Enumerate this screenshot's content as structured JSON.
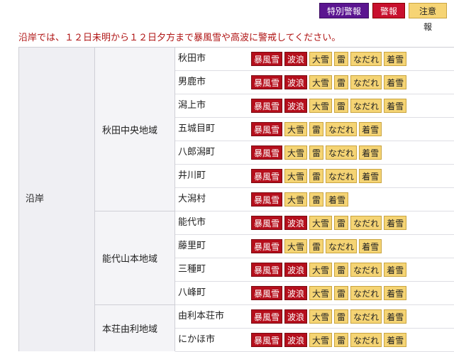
{
  "legend": {
    "special": "特別警報",
    "warning": "警報",
    "advisory": "注意報"
  },
  "notice": "沿岸では、１２日未明から１２日夕方まで暴風雪や高波に警戒してください。",
  "coast": "沿岸",
  "regions": [
    "秋田中央地域",
    "能代山本地域",
    "本荘由利地域"
  ],
  "rows": [
    {
      "city": "秋田市",
      "warnings": [
        "暴風雪",
        "波浪"
      ],
      "advisories": [
        "大雪",
        "雷",
        "なだれ",
        "着雪"
      ]
    },
    {
      "city": "男鹿市",
      "warnings": [
        "暴風雪",
        "波浪"
      ],
      "advisories": [
        "大雪",
        "雷",
        "なだれ",
        "着雪"
      ]
    },
    {
      "city": "潟上市",
      "warnings": [
        "暴風雪",
        "波浪"
      ],
      "advisories": [
        "大雪",
        "雷",
        "なだれ",
        "着雪"
      ]
    },
    {
      "city": "五城目町",
      "warnings": [
        "暴風雪"
      ],
      "advisories": [
        "大雪",
        "雷",
        "なだれ",
        "着雪"
      ]
    },
    {
      "city": "八郎潟町",
      "warnings": [
        "暴風雪"
      ],
      "advisories": [
        "大雪",
        "雷",
        "なだれ",
        "着雪"
      ]
    },
    {
      "city": "井川町",
      "warnings": [
        "暴風雪"
      ],
      "advisories": [
        "大雪",
        "雷",
        "なだれ",
        "着雪"
      ]
    },
    {
      "city": "大潟村",
      "warnings": [
        "暴風雪"
      ],
      "advisories": [
        "大雪",
        "雷",
        "着雪"
      ]
    },
    {
      "city": "能代市",
      "warnings": [
        "暴風雪",
        "波浪"
      ],
      "advisories": [
        "大雪",
        "雷",
        "なだれ",
        "着雪"
      ]
    },
    {
      "city": "藤里町",
      "warnings": [
        "暴風雪"
      ],
      "advisories": [
        "大雪",
        "雷",
        "なだれ",
        "着雪"
      ]
    },
    {
      "city": "三種町",
      "warnings": [
        "暴風雪",
        "波浪"
      ],
      "advisories": [
        "大雪",
        "雷",
        "なだれ",
        "着雪"
      ]
    },
    {
      "city": "八峰町",
      "warnings": [
        "暴風雪",
        "波浪"
      ],
      "advisories": [
        "大雪",
        "雷",
        "なだれ",
        "着雪"
      ]
    },
    {
      "city": "由利本荘市",
      "warnings": [
        "暴風雪",
        "波浪"
      ],
      "advisories": [
        "大雪",
        "雷",
        "なだれ",
        "着雪"
      ]
    },
    {
      "city": "にかほ市",
      "warnings": [
        "暴風雪",
        "波浪"
      ],
      "advisories": [
        "大雪",
        "雷",
        "なだれ",
        "着雪"
      ]
    }
  ],
  "colors": {
    "warning": "#b50f1c",
    "advisory": "#f5d474",
    "special": "#5b1590",
    "notice": "#b01515"
  }
}
